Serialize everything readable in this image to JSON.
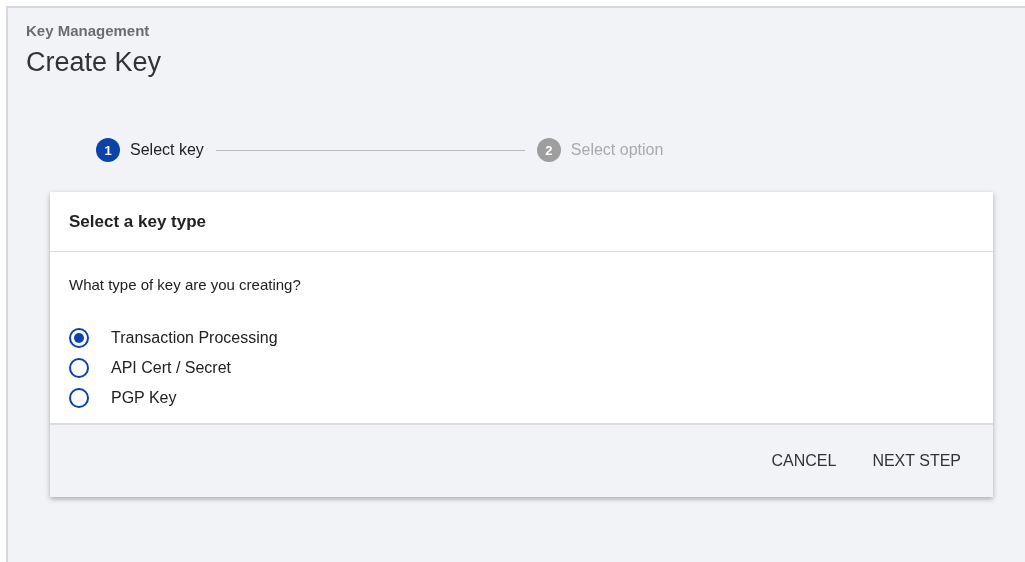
{
  "breadcrumb": "Key Management",
  "title": "Create Key",
  "steps": [
    {
      "number": "1",
      "label": "Select key",
      "active": true
    },
    {
      "number": "2",
      "label": "Select option",
      "active": false
    }
  ],
  "card": {
    "title": "Select a key type",
    "question": "What type of key are you creating?",
    "options": [
      {
        "label": "Transaction Processing",
        "selected": true
      },
      {
        "label": "API Cert / Secret",
        "selected": false
      },
      {
        "label": "PGP Key",
        "selected": false
      }
    ],
    "buttons": [
      "CANCEL",
      "NEXT STEP"
    ]
  }
}
